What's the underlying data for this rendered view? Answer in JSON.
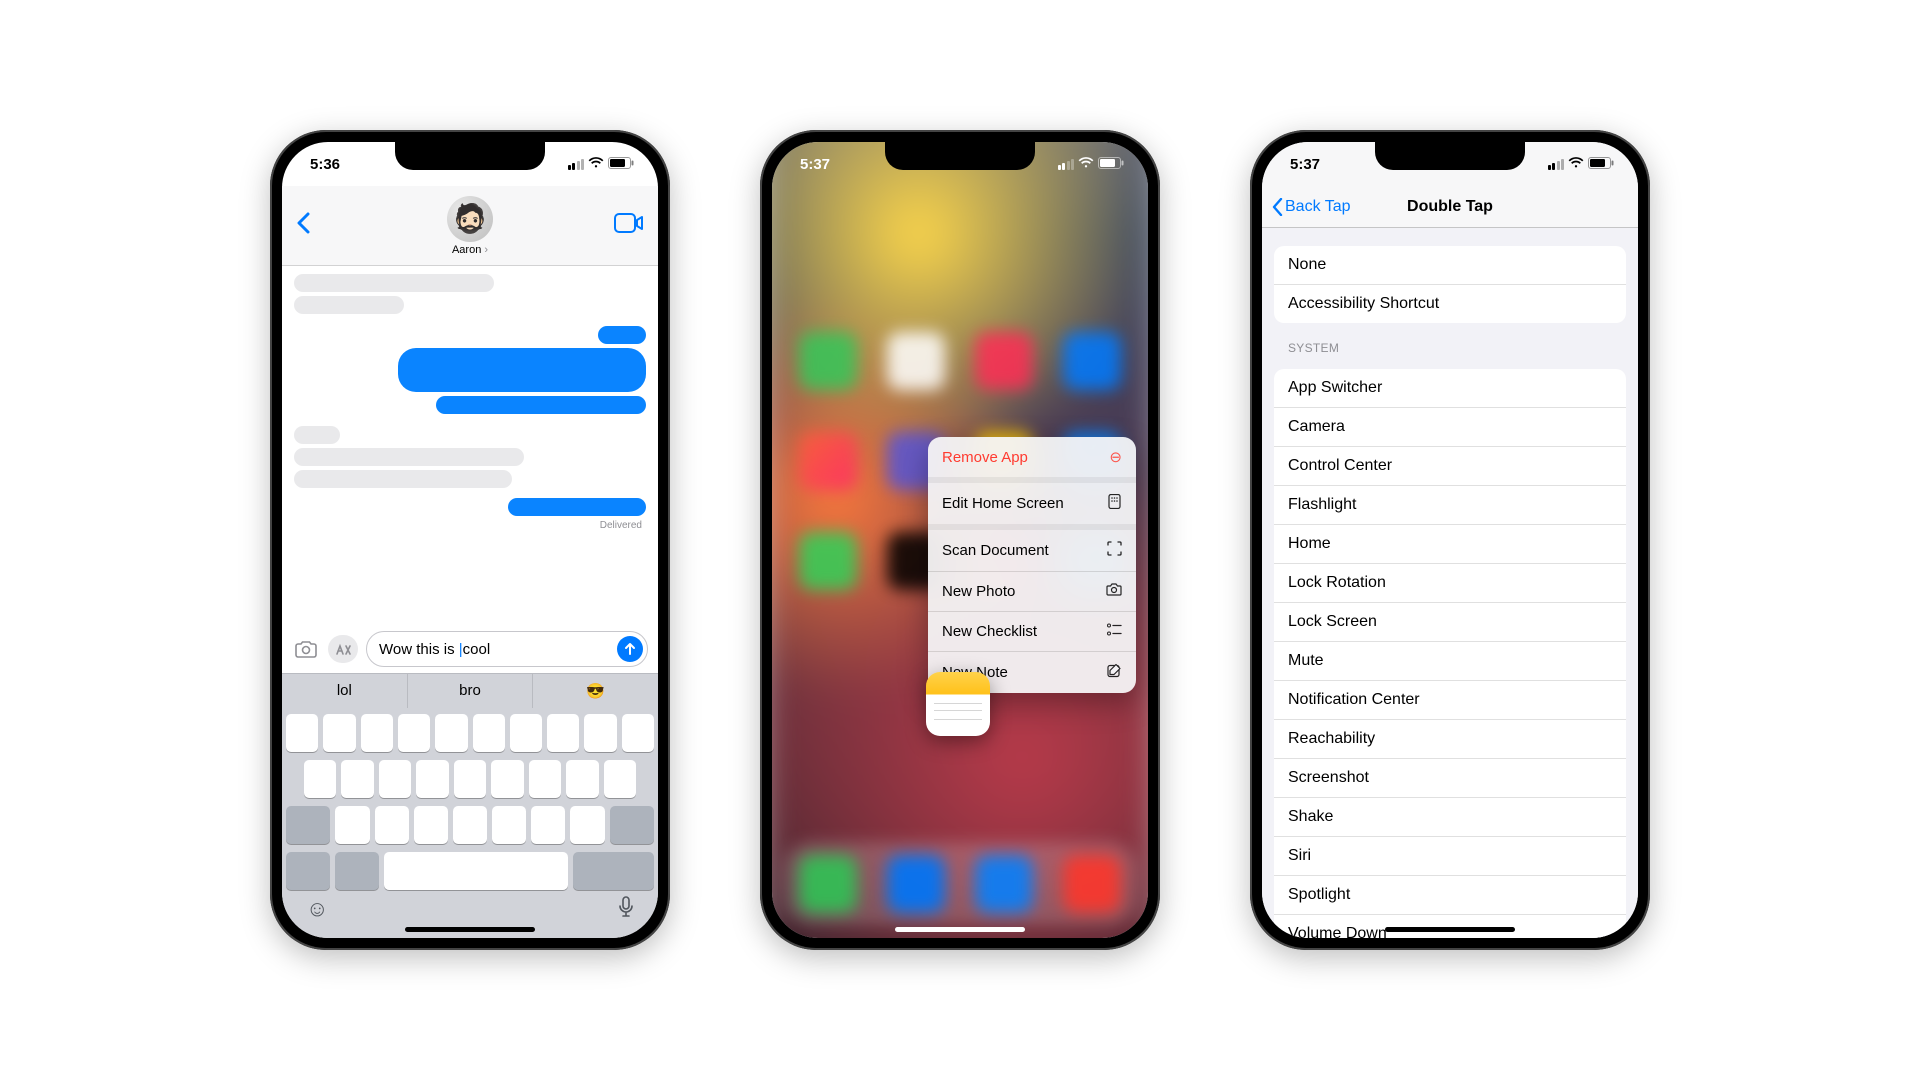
{
  "phones": {
    "messages": {
      "status_time": "5:36",
      "contact_name": "Aaron",
      "compose_text_prefix": "Wow this is ",
      "compose_text_suffix": "cool",
      "delivered_label": "Delivered",
      "predictions": [
        "lol",
        "bro",
        "😎"
      ]
    },
    "home": {
      "status_time": "5:37",
      "context_menu": [
        {
          "label": "Remove App",
          "icon": "⊖",
          "destructive": true,
          "sep": true
        },
        {
          "label": "Edit Home Screen",
          "icon": "▢",
          "sep": true
        },
        {
          "label": "Scan Document",
          "icon": "⛶"
        },
        {
          "label": "New Photo",
          "icon": "📷"
        },
        {
          "label": "New Checklist",
          "icon": "☰"
        },
        {
          "label": "New Note",
          "icon": "✎"
        }
      ],
      "focused_app": "Notes"
    },
    "settings": {
      "status_time": "5:37",
      "back_label": "Back Tap",
      "title": "Double Tap",
      "group_top": [
        "None",
        "Accessibility Shortcut"
      ],
      "section_label": "SYSTEM",
      "group_system": [
        "App Switcher",
        "Camera",
        "Control Center",
        "Flashlight",
        "Home",
        "Lock Rotation",
        "Lock Screen",
        "Mute",
        "Notification Center",
        "Reachability",
        "Screenshot",
        "Shake",
        "Siri",
        "Spotlight",
        "Volume Down"
      ]
    }
  }
}
